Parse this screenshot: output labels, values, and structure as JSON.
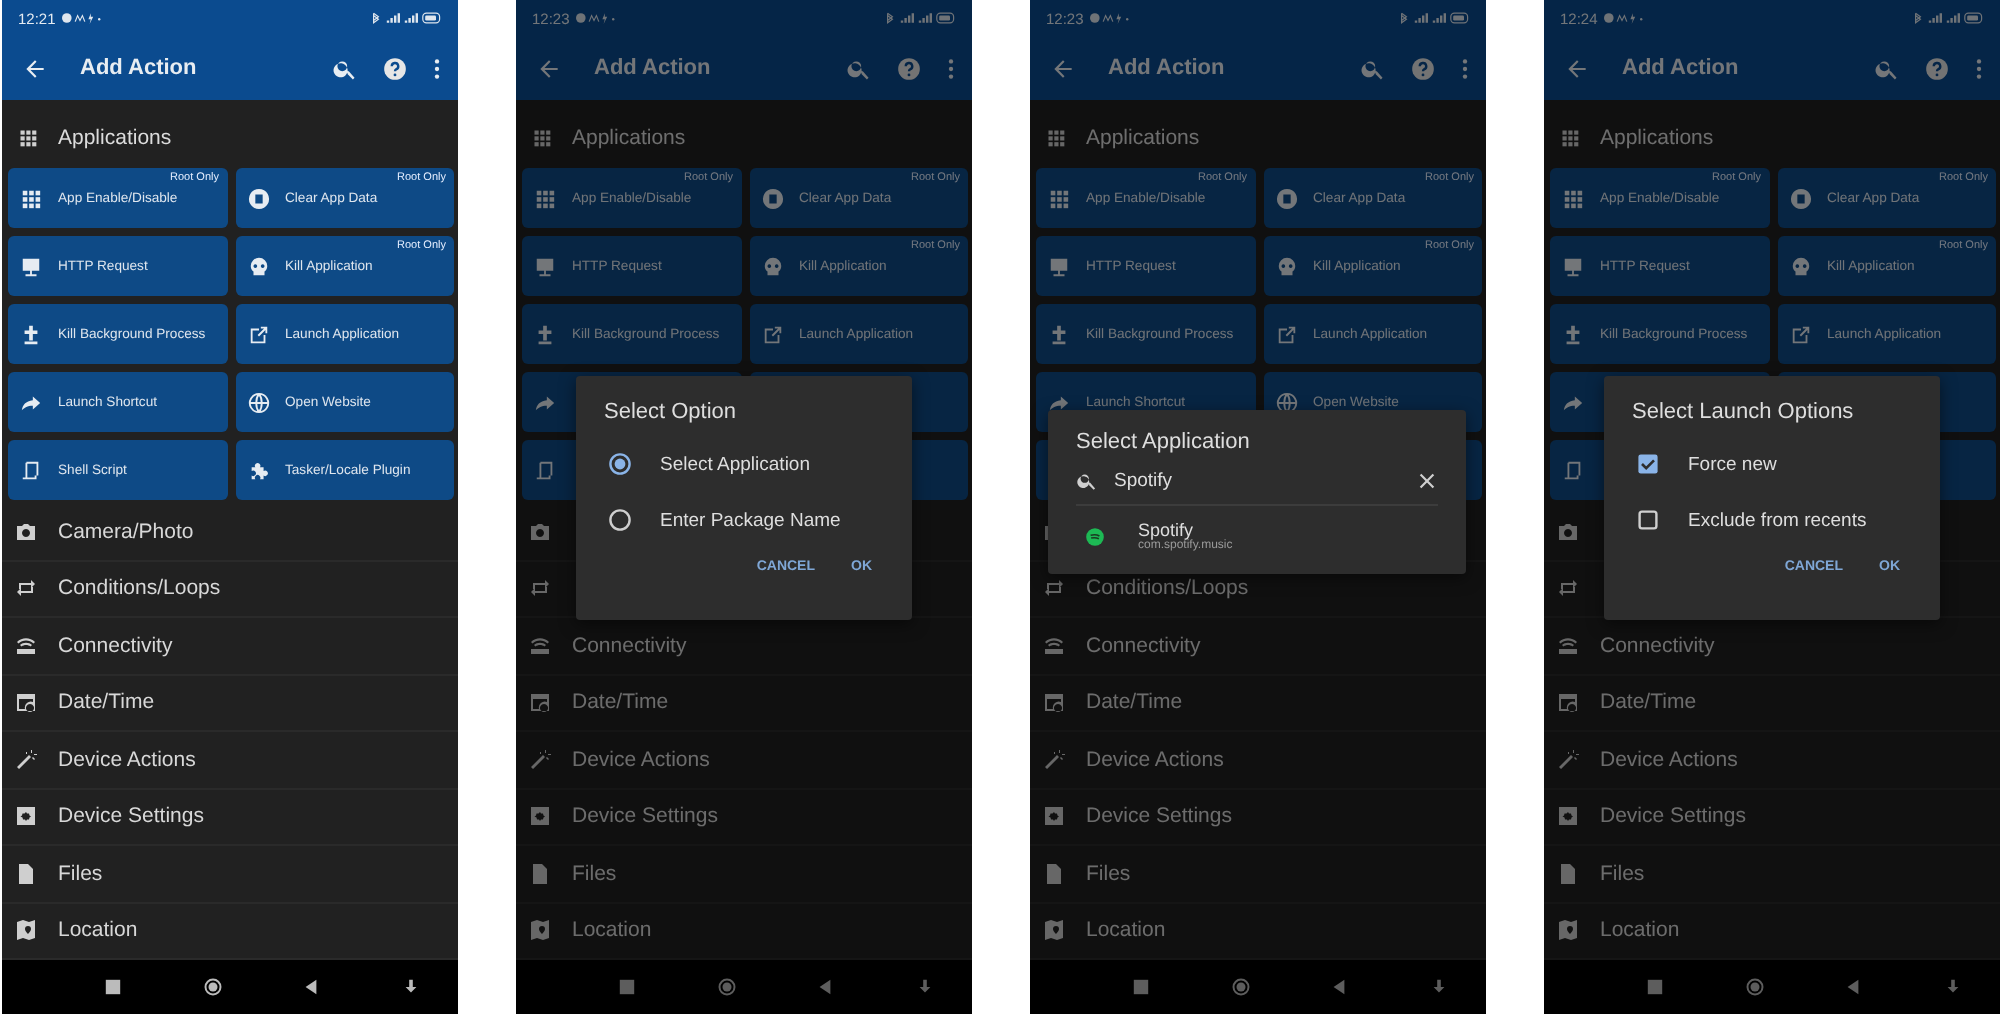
{
  "phones": [
    {
      "status_bar": {
        "time": "12:21"
      },
      "app_bar": {
        "title": "Add Action"
      },
      "section": {
        "title": "Applications"
      },
      "tile_rows": [
        {
          "tiles": [
            {
              "label": "App Enable/Disable",
              "badge": "Root Only"
            },
            {
              "label": "Clear App Data",
              "badge": "Root Only"
            }
          ]
        },
        {
          "tiles": [
            {
              "label": "HTTP Request"
            },
            {
              "label": "Kill Application",
              "badge": "Root Only"
            }
          ]
        },
        {
          "tiles": [
            {
              "label": "Kill Background Process"
            },
            {
              "label": "Launch Application"
            }
          ]
        },
        {
          "tiles": [
            {
              "label": "Launch Shortcut"
            },
            {
              "label": "Open Website"
            }
          ]
        },
        {
          "tiles": [
            {
              "label": "Shell Script"
            },
            {
              "label": "Tasker/Locale Plugin"
            }
          ]
        }
      ],
      "categories": [
        {
          "label": "Camera/Photo"
        },
        {
          "label": "Conditions/Loops"
        },
        {
          "label": "Connectivity"
        },
        {
          "label": "Date/Time"
        },
        {
          "label": "Device Actions"
        },
        {
          "label": "Device Settings"
        },
        {
          "label": "Files"
        },
        {
          "label": "Location"
        }
      ]
    },
    {
      "status_bar": {
        "time": "12:23"
      },
      "app_bar": {
        "title": "Add Action"
      },
      "section": {
        "title": "Applications"
      },
      "tile_rows": [
        {
          "tiles": [
            {
              "label": "App Enable/Disable",
              "badge": "Root Only"
            },
            {
              "label": "Clear App Data",
              "badge": "Root Only"
            }
          ]
        },
        {
          "tiles": [
            {
              "label": "HTTP Request"
            },
            {
              "label": "Kill Application",
              "badge": "Root Only"
            }
          ]
        },
        {
          "tiles": [
            {
              "label": "Kill Background Process"
            },
            {
              "label": "Launch Application"
            }
          ]
        }
      ],
      "categories": [
        {
          "label": "Connectivity"
        },
        {
          "label": "Date/Time"
        },
        {
          "label": "Device Actions"
        },
        {
          "label": "Device Settings"
        },
        {
          "label": "Files"
        },
        {
          "label": "Location"
        }
      ],
      "dialog": {
        "kind": "radio",
        "title": "Select Option",
        "items": [
          {
            "label": "Select Application",
            "selected": true
          },
          {
            "label": "Enter Package Name",
            "selected": false
          }
        ],
        "buttons": [
          "CANCEL",
          "OK"
        ]
      }
    },
    {
      "status_bar": {
        "time": "12:23"
      },
      "app_bar": {
        "title": "Add Action"
      },
      "section": {
        "title": "Applications"
      },
      "tile_rows": [
        {
          "tiles": [
            {
              "label": "App Enable/Disable",
              "badge": "Root Only"
            },
            {
              "label": "Clear App Data",
              "badge": "Root Only"
            }
          ]
        },
        {
          "tiles": [
            {
              "label": "HTTP Request"
            },
            {
              "label": "Kill Application",
              "badge": "Root Only"
            }
          ]
        },
        {
          "tiles": [
            {
              "label": "Kill Background Process"
            },
            {
              "label": "Launch Application"
            }
          ]
        },
        {
          "tiles": [
            {
              "label": "Launch Shortcut"
            },
            {
              "label": "Open Website"
            }
          ]
        }
      ],
      "categories": [
        {
          "label": "Conditions/Loops"
        },
        {
          "label": "Connectivity"
        },
        {
          "label": "Date/Time"
        },
        {
          "label": "Device Actions"
        },
        {
          "label": "Device Settings"
        },
        {
          "label": "Files"
        },
        {
          "label": "Location"
        }
      ],
      "dialog": {
        "kind": "search",
        "title": "Select Application",
        "search": {
          "value": "Spotify"
        },
        "results": [
          {
            "name": "Spotify",
            "package": "com.spotify.music"
          }
        ]
      }
    },
    {
      "status_bar": {
        "time": "12:24"
      },
      "app_bar": {
        "title": "Add Action"
      },
      "section": {
        "title": "Applications"
      },
      "tile_rows": [
        {
          "tiles": [
            {
              "label": "App Enable/Disable",
              "badge": "Root Only"
            },
            {
              "label": "Clear App Data",
              "badge": "Root Only"
            }
          ]
        },
        {
          "tiles": [
            {
              "label": "HTTP Request"
            },
            {
              "label": "Kill Application",
              "badge": "Root Only"
            }
          ]
        },
        {
          "tiles": [
            {
              "label": "Kill Background Process"
            },
            {
              "label": "Launch Application"
            }
          ]
        }
      ],
      "categories": [
        {
          "label": "Connectivity"
        },
        {
          "label": "Date/Time"
        },
        {
          "label": "Device Actions"
        },
        {
          "label": "Device Settings"
        },
        {
          "label": "Files"
        },
        {
          "label": "Location"
        }
      ],
      "dialog": {
        "kind": "checkbox",
        "title": "Select Launch Options",
        "items": [
          {
            "label": "Force new",
            "checked": true
          },
          {
            "label": "Exclude from recents",
            "checked": false
          }
        ],
        "buttons": [
          "CANCEL",
          "OK"
        ]
      }
    }
  ]
}
